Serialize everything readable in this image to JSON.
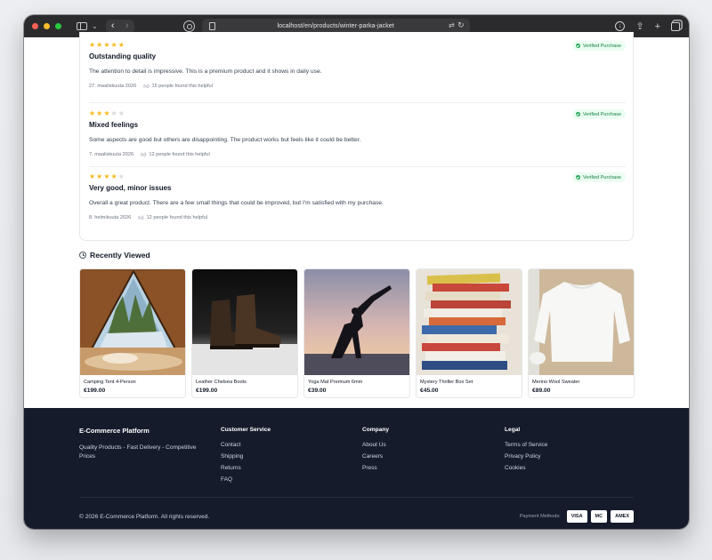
{
  "browser": {
    "url": "localhost/en/products/winter-parka-jacket"
  },
  "reviews": [
    {
      "rating": 5,
      "title": "Outstanding quality",
      "body": "The attention to detail is impressive. This is a premium product and it shows in daily use.",
      "date": "27. maaliskuuta 2026",
      "helpful": "15 people found this helpful",
      "verified": "Verified Purchase"
    },
    {
      "rating": 3,
      "title": "Mixed feelings",
      "body": "Some aspects are good but others are disappointing. The product works but feels like it could be better.",
      "date": "7. maaliskuuta 2026",
      "helpful": "12 people found this helpful",
      "verified": "Verified Purchase"
    },
    {
      "rating": 4,
      "title": "Very good, minor issues",
      "body": "Overall a great product. There are a few small things that could be improved, but I'm satisfied with my purchase.",
      "date": "8. helmikuuta 2026",
      "helpful": "12 people found this helpful",
      "verified": "Verified Purchase"
    }
  ],
  "recently_viewed": {
    "title": "Recently Viewed",
    "items": [
      {
        "name": "Camping Tent 4-Person",
        "price": "€199.00"
      },
      {
        "name": "Leather Chelsea Boots",
        "price": "€199.00"
      },
      {
        "name": "Yoga Mat Premium 6mm",
        "price": "€39.00"
      },
      {
        "name": "Mystery Thriller Box Set",
        "price": "€45.00"
      },
      {
        "name": "Merino Wool Sweater",
        "price": "€89.00"
      }
    ]
  },
  "footer": {
    "brand": "E-Commerce Platform",
    "tagline": "Quality Products - Fast Delivery - Competitive Prices",
    "customer_service": {
      "heading": "Customer Service",
      "links": [
        "Contact",
        "Shipping",
        "Returns",
        "FAQ"
      ]
    },
    "company": {
      "heading": "Company",
      "links": [
        "About Us",
        "Careers",
        "Press"
      ]
    },
    "legal": {
      "heading": "Legal",
      "links": [
        "Terms of Service",
        "Privacy Policy",
        "Cookies"
      ]
    },
    "copyright": "© 2026 E-Commerce Platform. All rights reserved.",
    "payment_label": "Payment Methods:",
    "payment_methods": [
      "VISA",
      "MC",
      "AMEX"
    ]
  },
  "colors": {
    "footer_bg": "#151b2b",
    "star": "#f5b91b",
    "verified_green": "#15803d"
  }
}
